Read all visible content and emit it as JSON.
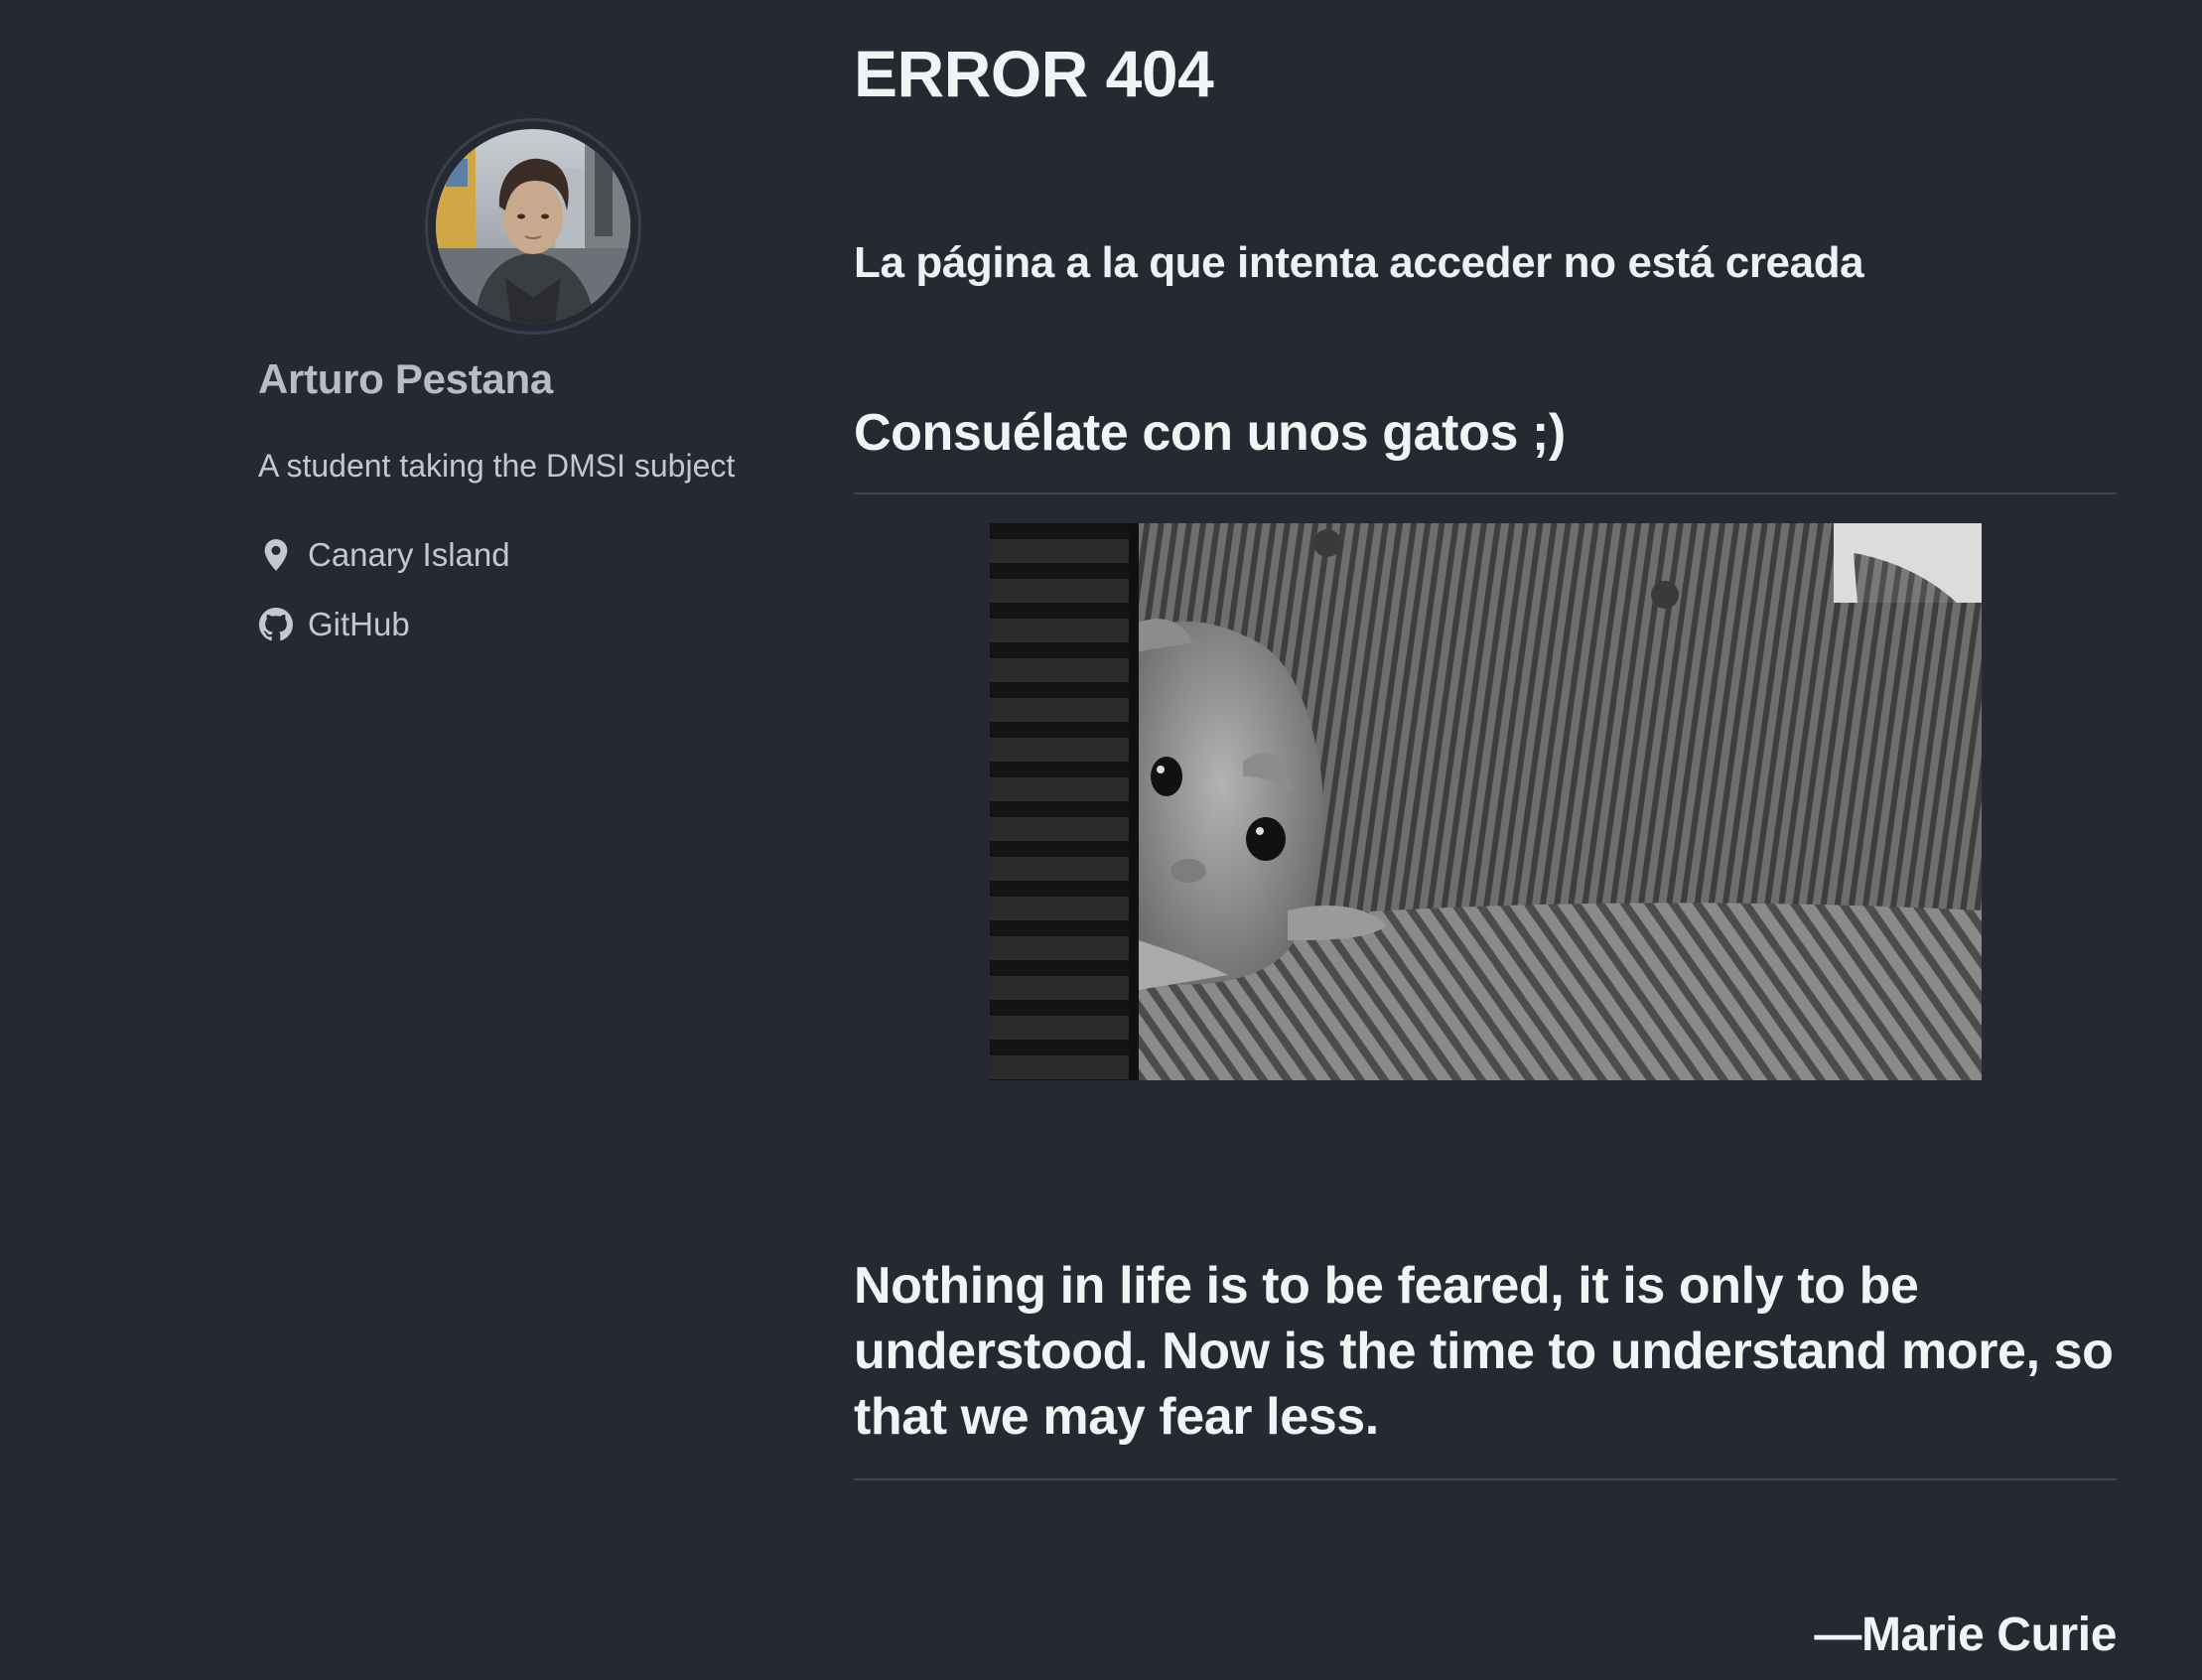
{
  "sidebar": {
    "avatar_alt": "Arturo Pestana",
    "name": "Arturo Pestana",
    "bio": "A student taking the DMSI subject",
    "links": [
      {
        "icon": "map-pin-icon",
        "label": "Canary Island"
      },
      {
        "icon": "github-icon",
        "label": "GitHub"
      }
    ]
  },
  "main": {
    "title": "ERROR 404",
    "subtitle": "La página a la que intenta acceder no está creada",
    "section_heading": "Consuélate con unos gatos ;)",
    "image_alt": "cat",
    "quote": "Nothing in life is to be feared, it is only to be understood. Now is the time to understand more, so that we may fear less.",
    "quote_author": "—Marie Curie"
  },
  "colors": {
    "background": "#252932",
    "text": "#e8eaee",
    "muted_text": "#c4c7cd",
    "rule": "#3f4550"
  }
}
